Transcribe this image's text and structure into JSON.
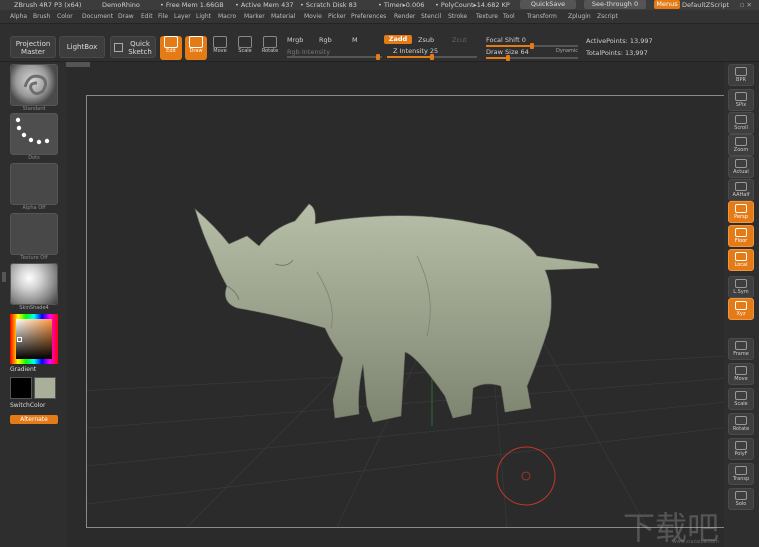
{
  "titlebar": {
    "app": "ZBrush 4R7 P3 (x64)",
    "doc": "DemoRhino",
    "free_mem": "• Free Mem 1.66GB",
    "active_mem": "• Active Mem 437",
    "scratch": "• Scratch Disk 83",
    "timer": "• Timer▸0.006",
    "polycount": "• PolyCount▸14.682 KP",
    "quicksave": "QuickSave",
    "seethrough": "See-through  0",
    "menus": "Menus",
    "script": "DefaultZScript"
  },
  "menubar": [
    "Alpha",
    "Brush",
    "Color",
    "Document",
    "Draw",
    "Edit",
    "File",
    "Layer",
    "Light",
    "Macro",
    "Marker",
    "Material",
    "Movie",
    "Picker",
    "Preferences",
    "Render",
    "Stencil",
    "Stroke",
    "Texture",
    "Tool",
    "Transform",
    "Zplugin",
    "Zscript"
  ],
  "toolbar": {
    "projection_master": "Projection Master",
    "lightbox": "LightBox",
    "quick_sketch": "Quick Sketch",
    "tools": [
      {
        "label": "Edit",
        "active": true
      },
      {
        "label": "Draw",
        "active": true
      },
      {
        "label": "Move",
        "active": false
      },
      {
        "label": "Scale",
        "active": false
      },
      {
        "label": "Rotate",
        "active": false
      }
    ],
    "mrgb": "Mrgb",
    "rgb": "Rgb",
    "m": "M",
    "rgb_intensity": "Rgb Intensity",
    "zadd": "Zadd",
    "zsub": "Zsub",
    "zcut": "Zcut",
    "z_intensity_label": "Z Intensity",
    "z_intensity": "25",
    "focal_shift_label": "Focal Shift",
    "focal_shift": "0",
    "draw_size_label": "Draw Size",
    "draw_size": "64",
    "dynamic": "Dynamic",
    "active_points": "ActivePoints: 13,997",
    "total_points": "TotalPoints: 13,997"
  },
  "lefttray": {
    "brush": "Standard",
    "stroke": "Dots",
    "alpha": "Alpha Off",
    "texture": "Texture Off",
    "material": "SkinShade4",
    "gradient": "Gradient",
    "switch_color": "SwitchColor",
    "alternate": "Alternate"
  },
  "rightshelf": [
    {
      "label": "BPR",
      "on": false
    },
    {
      "label": "SPix",
      "on": false
    },
    {
      "label": "Scroll",
      "on": false
    },
    {
      "label": "Zoom",
      "on": false
    },
    {
      "label": "Actual",
      "on": false
    },
    {
      "label": "AAHalf",
      "on": false
    },
    {
      "label": "Persp",
      "on": true
    },
    {
      "label": "Floor",
      "on": true
    },
    {
      "label": "Local",
      "on": true
    },
    {
      "label": "L.Sym",
      "on": false
    },
    {
      "label": "Xyz",
      "on": true
    },
    {
      "label": "Frame",
      "on": false
    },
    {
      "label": "Move",
      "on": false
    },
    {
      "label": "Scale",
      "on": false
    },
    {
      "label": "Rotate",
      "on": false
    },
    {
      "label": "PolyF",
      "on": false
    },
    {
      "label": "Transp",
      "on": false
    },
    {
      "label": "Solo",
      "on": false
    }
  ],
  "watermark": "下载吧",
  "watermark_url": "www.xiazaiba.com",
  "colors": {
    "accent": "#e47b16",
    "clay": "#a9b09a",
    "brush_cursor": "#c0392b"
  }
}
